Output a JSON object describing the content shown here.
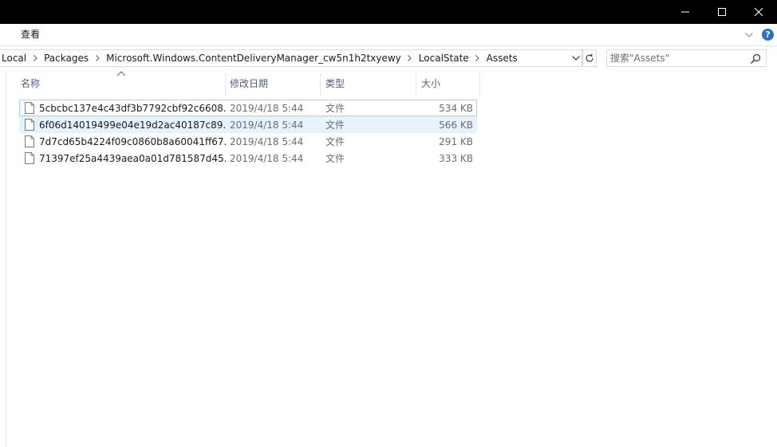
{
  "ribbon": {
    "view_tab": "查看"
  },
  "address": {
    "crumbs": [
      "Local",
      "Packages",
      "Microsoft.Windows.ContentDeliveryManager_cw5n1h2txyewy",
      "LocalState",
      "Assets"
    ]
  },
  "search": {
    "placeholder": "搜索\"Assets\""
  },
  "columns": {
    "name": "名称",
    "date": "修改日期",
    "type": "类型",
    "size": "大小"
  },
  "files": [
    {
      "name": "5cbcbc137e4c43df3b7792cbf92c6608...",
      "date": "2019/4/18 5:44",
      "type": "文件",
      "size": "534 KB"
    },
    {
      "name": "6f06d14019499e04e19d2ac40187c89...",
      "date": "2019/4/18 5:44",
      "type": "文件",
      "size": "566 KB"
    },
    {
      "name": "7d7cd65b4224f09c0860b8a60041ff67...",
      "date": "2019/4/18 5:44",
      "type": "文件",
      "size": "291 KB"
    },
    {
      "name": "71397ef25a4439aea0a01d781587d45...",
      "date": "2019/4/18 5:44",
      "type": "文件",
      "size": "333 KB"
    }
  ],
  "colors": {
    "accent": "#1e74d0",
    "selection": "#e5f3ff",
    "focus_border": "#99d1ff",
    "header_text": "#4c607a"
  }
}
